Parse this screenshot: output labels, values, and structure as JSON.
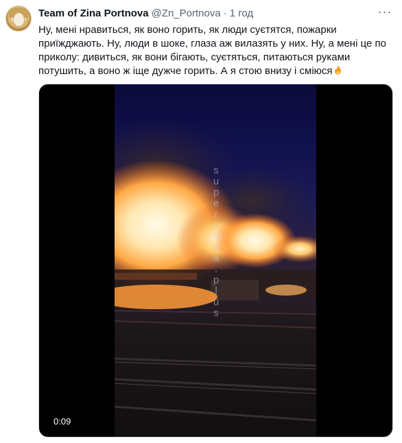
{
  "tweet": {
    "author_name": "Team of Zina Portnova",
    "handle": "@Zn_Portnova",
    "separator": "·",
    "time": "1 год",
    "text": "Ну, мені нравиться, як воно горить, як люди суєтятся, пожарки приїжджають. Ну, люди в шоке, глаза аж вилазять у них. Ну, а мені це по приколу: дивиться, як вони бігають, суєтяться, питаються руками потушить, а воно ж іще дужче горить. А я стою внизу і сміюся",
    "more_glyph": "···"
  },
  "video": {
    "watermark": [
      "s",
      "u",
      "p",
      "e",
      "r",
      "n",
      "o",
      "v",
      "a",
      ".",
      "p",
      "l",
      "u",
      "s"
    ],
    "duration": "0:09"
  }
}
